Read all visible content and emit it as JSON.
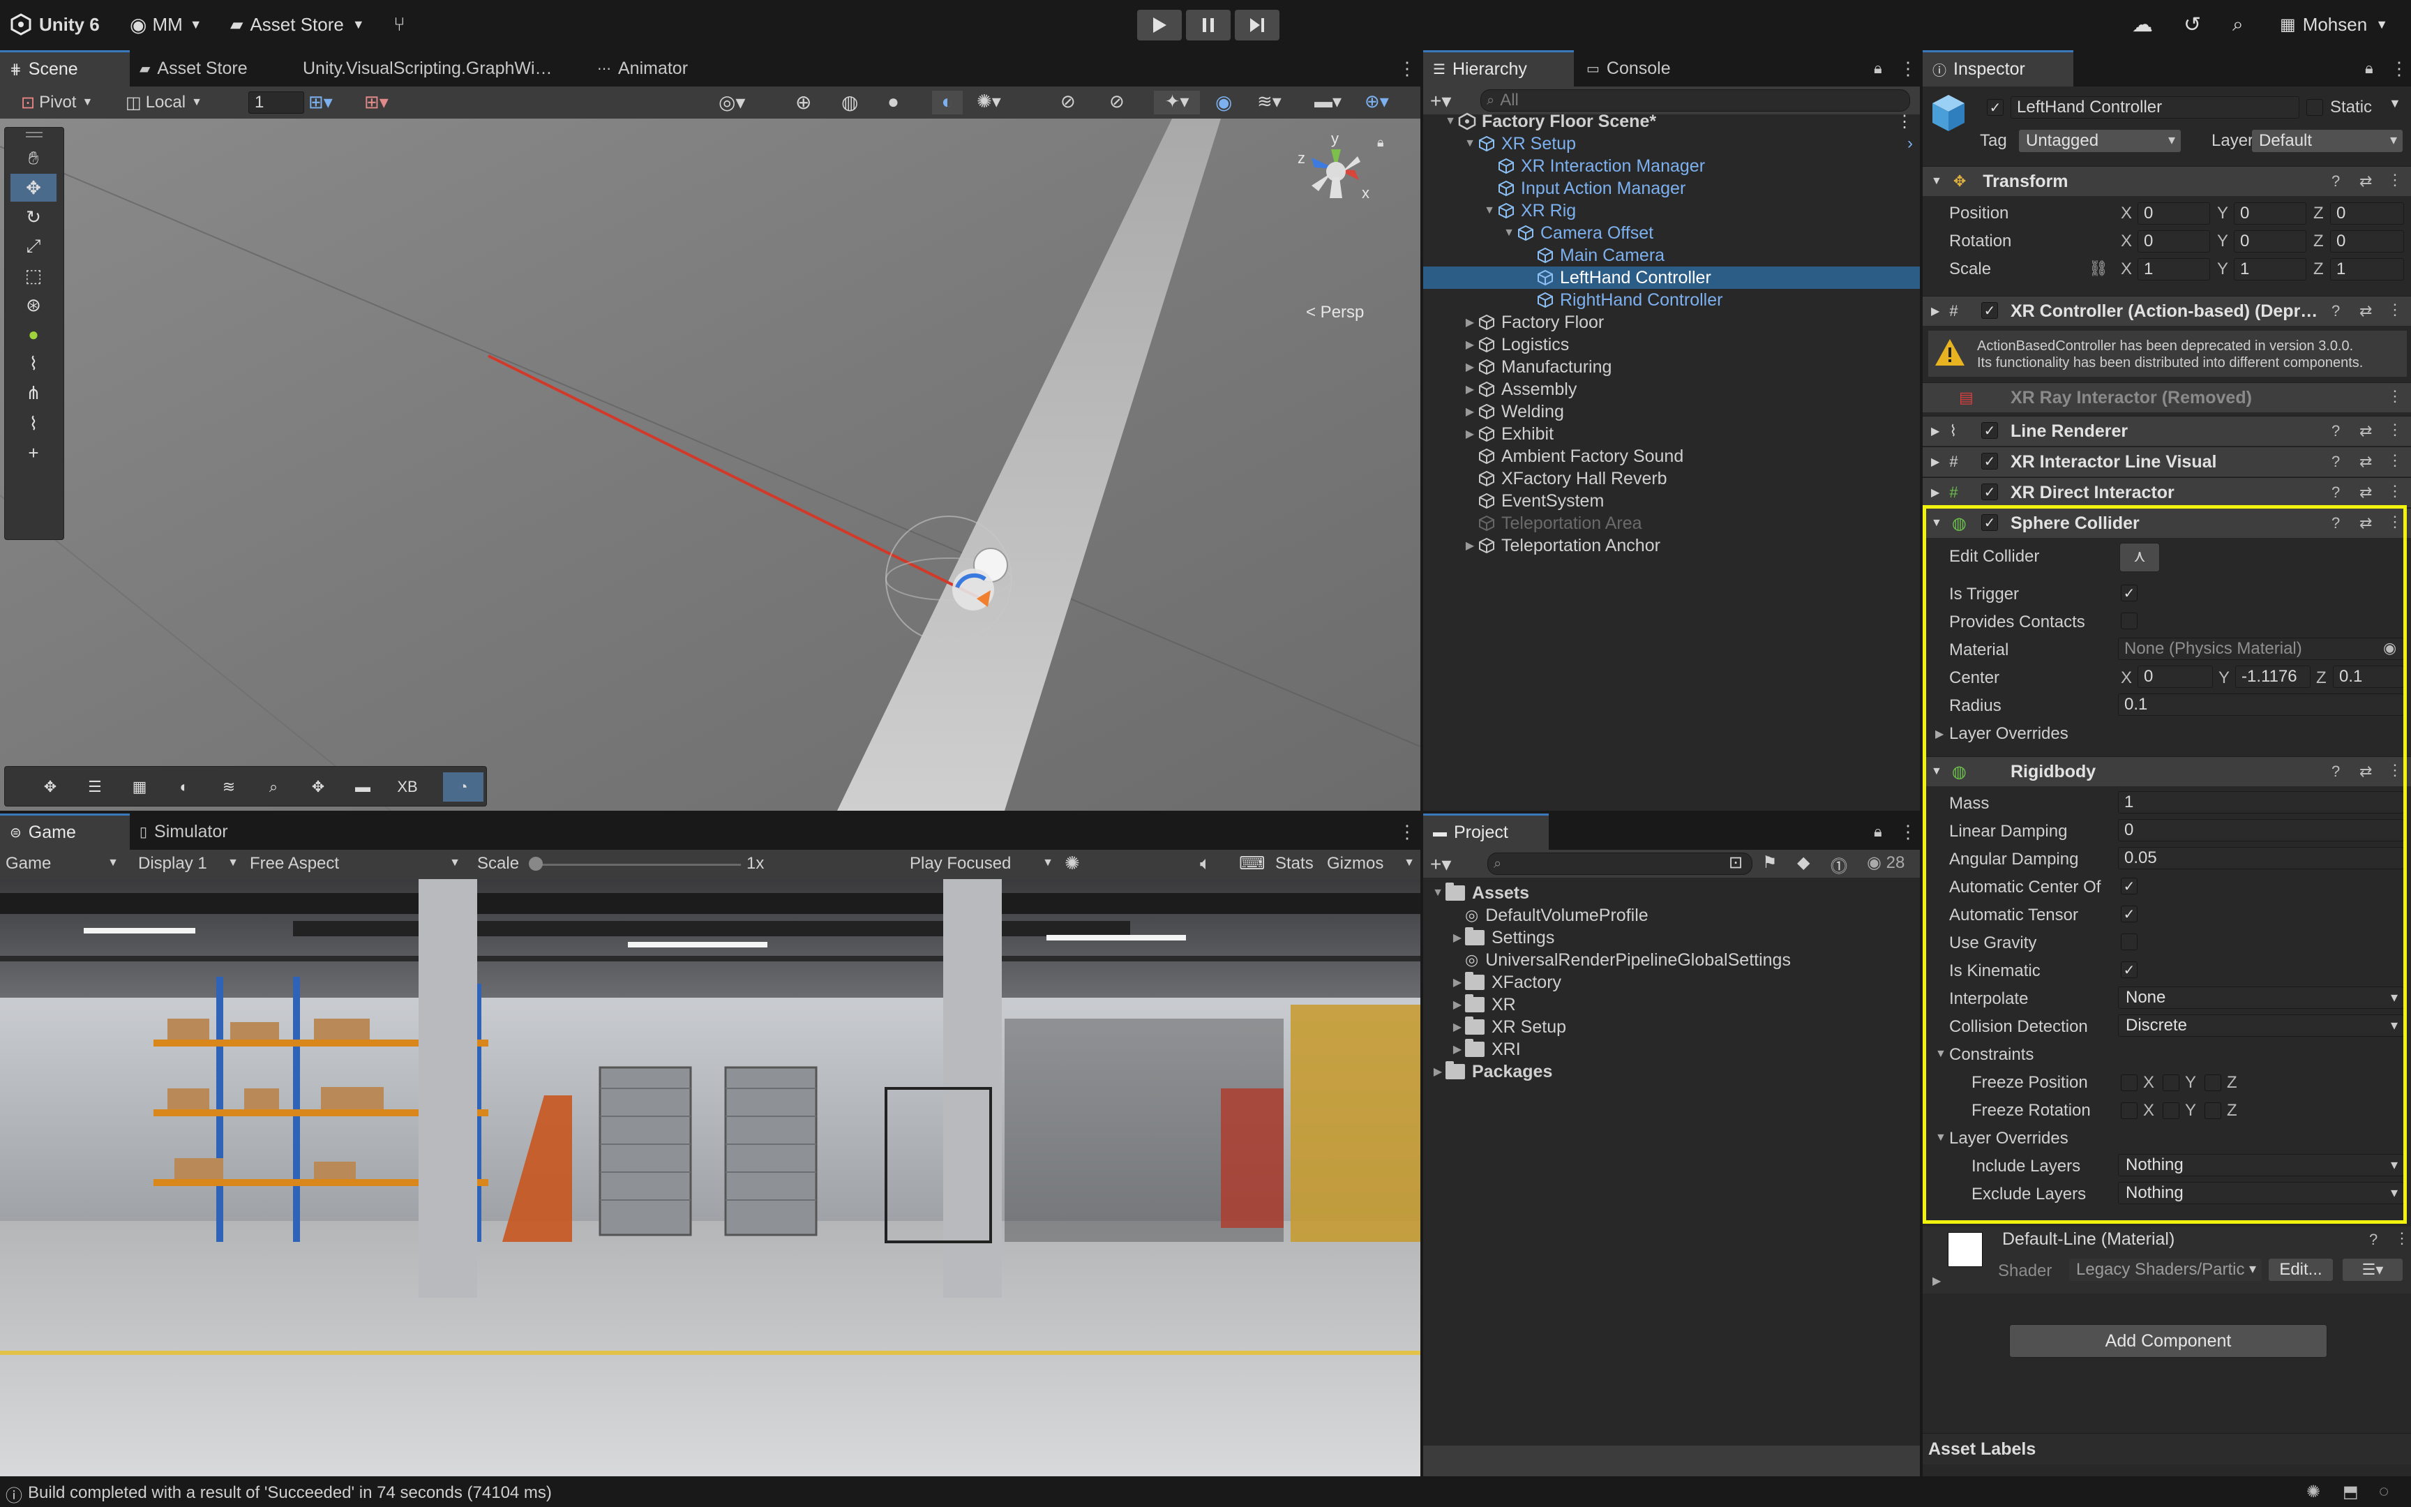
{
  "top": {
    "app": "Unity 6",
    "account": "MM",
    "store": "Asset Store",
    "user": "Mohsen"
  },
  "scene_tabs": [
    "Scene",
    "Asset Store",
    "Unity.VisualScripting.GraphWindo",
    "Animator"
  ],
  "scene_toolbar": {
    "pivot": "Pivot",
    "local": "Local",
    "grid_value": "1",
    "persp": "< Persp"
  },
  "gizmo": {
    "y": "y",
    "z": "z",
    "x": "x"
  },
  "scene_bottom_tools": {
    "xb": "XB"
  },
  "game_tabs": [
    "Game",
    "Simulator"
  ],
  "game_toolbar": {
    "mode": "Game",
    "display": "Display 1",
    "aspect": "Free Aspect",
    "scale_label": "Scale",
    "scale_value": "1x",
    "play_focused": "Play Focused",
    "stats": "Stats",
    "gizmos": "Gizmos"
  },
  "hierarchy": {
    "tabs": [
      "Hierarchy",
      "Console"
    ],
    "search_placeholder": "All",
    "items": [
      {
        "label": "Factory Floor Scene*",
        "depth": 0,
        "kind": "scene",
        "style": "bold",
        "arrow": "open"
      },
      {
        "label": "XR Setup",
        "depth": 1,
        "kind": "cube",
        "style": "blue",
        "arrow": "open"
      },
      {
        "label": "XR Interaction Manager",
        "depth": 2,
        "kind": "cube",
        "style": "blue",
        "arrow": "none"
      },
      {
        "label": "Input Action Manager",
        "depth": 2,
        "kind": "cube",
        "style": "blue",
        "arrow": "none"
      },
      {
        "label": "XR Rig",
        "depth": 2,
        "kind": "cube",
        "style": "blue",
        "arrow": "open"
      },
      {
        "label": "Camera Offset",
        "depth": 3,
        "kind": "cube",
        "style": "blue",
        "arrow": "open"
      },
      {
        "label": "Main Camera",
        "depth": 4,
        "kind": "cube",
        "style": "blue",
        "arrow": "none"
      },
      {
        "label": "LeftHand Controller",
        "depth": 4,
        "kind": "cube",
        "style": "sel",
        "arrow": "none"
      },
      {
        "label": "RightHand Controller",
        "depth": 4,
        "kind": "cube",
        "style": "blue",
        "arrow": "none"
      },
      {
        "label": "Factory Floor",
        "depth": 1,
        "kind": "cube",
        "style": "normal",
        "arrow": "closed"
      },
      {
        "label": "Logistics",
        "depth": 1,
        "kind": "cube",
        "style": "normal",
        "arrow": "closed"
      },
      {
        "label": "Manufacturing",
        "depth": 1,
        "kind": "cube",
        "style": "normal",
        "arrow": "closed"
      },
      {
        "label": "Assembly",
        "depth": 1,
        "kind": "cube",
        "style": "normal",
        "arrow": "closed"
      },
      {
        "label": "Welding",
        "depth": 1,
        "kind": "cube",
        "style": "normal",
        "arrow": "closed"
      },
      {
        "label": "Exhibit",
        "depth": 1,
        "kind": "cube",
        "style": "normal",
        "arrow": "closed"
      },
      {
        "label": "Ambient Factory Sound",
        "depth": 1,
        "kind": "cube",
        "style": "normal",
        "arrow": "none"
      },
      {
        "label": "XFactory Hall Reverb",
        "depth": 1,
        "kind": "cube",
        "style": "normal",
        "arrow": "none"
      },
      {
        "label": "EventSystem",
        "depth": 1,
        "kind": "cube",
        "style": "normal",
        "arrow": "none"
      },
      {
        "label": "Teleportation Area",
        "depth": 1,
        "kind": "cube",
        "style": "dim",
        "arrow": "none"
      },
      {
        "label": "Teleportation Anchor",
        "depth": 1,
        "kind": "cube",
        "style": "normal",
        "arrow": "closed"
      }
    ]
  },
  "project": {
    "tab": "Project",
    "count": "28",
    "items": [
      {
        "label": "Assets",
        "depth": 0,
        "kind": "folder",
        "arrow": "open",
        "bold": true
      },
      {
        "label": "DefaultVolumeProfile",
        "depth": 1,
        "kind": "asset",
        "arrow": "none",
        "bold": false
      },
      {
        "label": "Settings",
        "depth": 1,
        "kind": "folder",
        "arrow": "closed",
        "bold": false
      },
      {
        "label": "UniversalRenderPipelineGlobalSettings",
        "depth": 1,
        "kind": "asset",
        "arrow": "none",
        "bold": false
      },
      {
        "label": "XFactory",
        "depth": 1,
        "kind": "folder",
        "arrow": "closed",
        "bold": false
      },
      {
        "label": "XR",
        "depth": 1,
        "kind": "folder",
        "arrow": "closed",
        "bold": false
      },
      {
        "label": "XR Setup",
        "depth": 1,
        "kind": "folder",
        "arrow": "closed",
        "bold": false
      },
      {
        "label": "XRI",
        "depth": 1,
        "kind": "folder",
        "arrow": "closed",
        "bold": false
      },
      {
        "label": "Packages",
        "depth": 0,
        "kind": "folder",
        "arrow": "closed",
        "bold": true
      }
    ]
  },
  "inspector": {
    "tab": "Inspector",
    "object_name": "LeftHand Controller",
    "static": "Static",
    "tag_label": "Tag",
    "tag_value": "Untagged",
    "layer_label": "Layer",
    "layer_value": "Default",
    "transform": {
      "title": "Transform",
      "position": {
        "label": "Position",
        "x": "0",
        "y": "0",
        "z": "0"
      },
      "rotation": {
        "label": "Rotation",
        "x": "0",
        "y": "0",
        "z": "0"
      },
      "scale": {
        "label": "Scale",
        "x": "1",
        "y": "1",
        "z": "1"
      }
    },
    "xr_controller": "XR Controller (Action-based) (Depreca",
    "warning": "ActionBasedController has been deprecated in version 3.0.0.\nIts functionality has been distributed into different components.",
    "ray_interactor": "XR Ray Interactor (Removed)",
    "line_renderer": "Line Renderer",
    "line_visual": "XR Interactor Line Visual",
    "direct_interactor": "XR Direct Interactor",
    "sphere_collider": {
      "title": "Sphere Collider",
      "edit_collider": "Edit Collider",
      "is_trigger": "Is Trigger",
      "provides_contacts": "Provides Contacts",
      "material_label": "Material",
      "material_value": "None (Physics Material)",
      "center_label": "Center",
      "center": {
        "x": "0",
        "y": "-1.1176",
        "z": "0.1"
      },
      "radius_label": "Radius",
      "radius": "0.1",
      "layer_overrides": "Layer Overrides"
    },
    "rigidbody": {
      "title": "Rigidbody",
      "mass_label": "Mass",
      "mass": "1",
      "linear_damping_label": "Linear Damping",
      "linear_damping": "0",
      "angular_damping_label": "Angular Damping",
      "angular_damping": "0.05",
      "auto_com": "Automatic Center Of",
      "auto_tensor": "Automatic Tensor",
      "use_gravity": "Use Gravity",
      "is_kinematic": "Is Kinematic",
      "interpolate_label": "Interpolate",
      "interpolate": "None",
      "collision_label": "Collision Detection",
      "collision": "Discrete",
      "constraints": "Constraints",
      "freeze_position": "Freeze Position",
      "freeze_rotation": "Freeze Rotation",
      "layer_overrides": "Layer Overrides",
      "include_label": "Include Layers",
      "include": "Nothing",
      "exclude_label": "Exclude Layers",
      "exclude": "Nothing"
    },
    "material": {
      "name": "Default-Line (Material)",
      "shader_label": "Shader",
      "shader_value": "Legacy Shaders/Partic",
      "edit": "Edit..."
    },
    "add_component": "Add Component",
    "asset_labels": "Asset Labels"
  },
  "axes": {
    "x": "X",
    "y": "Y",
    "z": "Z"
  },
  "status": "Build completed with a result of 'Succeeded' in 74 seconds (74104 ms)",
  "colors": {
    "accent": "#3a79bb",
    "highlight": "#f2f20f",
    "selection": "#2c5d87",
    "warning": "#e8b320"
  }
}
